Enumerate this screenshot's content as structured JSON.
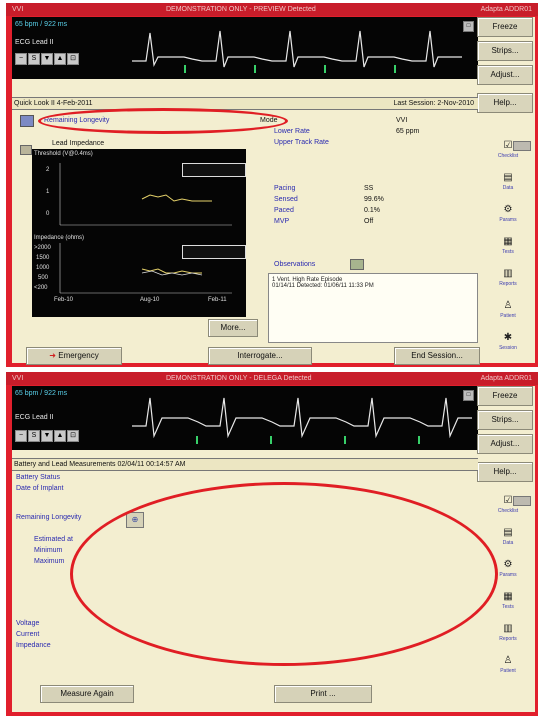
{
  "screen1": {
    "title_left": "VVI",
    "title_center": "DEMONSTRATION ONLY - PREVIEW Detected",
    "title_right": "Adapta ADDR01",
    "ecg": {
      "rate": "65 bpm / 922 ms",
      "lead": "ECG Lead II"
    },
    "buttons": [
      "Freeze",
      "Strips...",
      "Adjust...",
      "Help..."
    ],
    "quicklook": "Quick Look II 4-Feb-2011",
    "last_session": "Last Session: 2-Nov-2010",
    "remaining_longevity": "Remaining Longevity",
    "lead_impedance_label": "Lead Impedance",
    "threshold_label": "Threshold (V@0.4ms)",
    "impedance_label": "Impedance (ohms)",
    "y_threshold": [
      "2",
      "1",
      "0"
    ],
    "y_impedance": [
      ">2000",
      "1500",
      "1000",
      "500",
      "<200"
    ],
    "x_ticks": [
      "Feb-10",
      "Aug-10",
      "Feb-11"
    ],
    "mode_label": "Mode",
    "mode_value": "VVI",
    "lower_rate_label": "Lower Rate",
    "lower_rate_value": "65 ppm",
    "upper_track_label": "Upper Track Rate",
    "pacing_label": "Pacing",
    "pacing_value": "SS",
    "sensed_label": "Sensed",
    "sensed_value": "99.6%",
    "paced_label": "Paced",
    "paced_value": "0.1%",
    "mvp_label": "MVP",
    "mvp_value": "Off",
    "observations_label": "Observations",
    "observations": [
      "1 Vent. High Rate Episode",
      "01/14/11 Detected: 01/06/11 11:33 PM"
    ],
    "more_button": "More...",
    "emergency_button": "Emergency",
    "interrogate_button": "Interrogate...",
    "end_session_button": "End Session...",
    "tools": [
      "Checklist",
      "Data",
      "Params",
      "Tests",
      "Reports",
      "Patient",
      "Session"
    ]
  },
  "screen2": {
    "title_left": "VVI",
    "title_center": "DEMONSTRATION ONLY - DELEGA Detected",
    "title_right": "Adapta ADDR01",
    "ecg": {
      "rate": "65 bpm / 922 ms",
      "lead": "ECG Lead II"
    },
    "buttons": [
      "Freeze",
      "Strips...",
      "Adjust...",
      "Help..."
    ],
    "heading": "Battery and Lead Measurements 02/04/11 00:14:57 AM",
    "battery_status": "Battery Status",
    "date_of_implant": "Date of Implant",
    "remaining_longevity": "Remaining Longevity",
    "estimated_at": "Estimated at",
    "minimum": "Minimum",
    "maximum": "Maximum",
    "voltage": "Voltage",
    "current": "Current",
    "impedance": "Impedance",
    "measure_again_button": "Measure Again",
    "print_button": "Print ...",
    "tools": [
      "Checklist",
      "Data",
      "Params",
      "Tests",
      "Reports",
      "Patient"
    ]
  },
  "colors": {
    "frame": "#e11f2c",
    "panel": "#f3eed0",
    "link_text": "#2a2ab0",
    "annotation": "#e01e24"
  }
}
